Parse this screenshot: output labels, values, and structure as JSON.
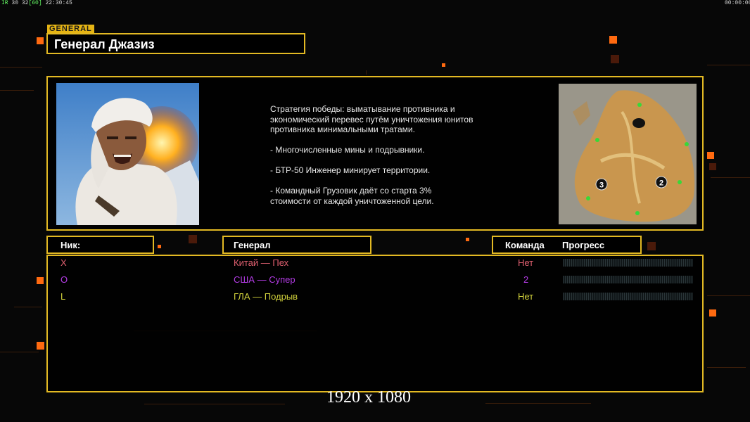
{
  "hud": {
    "stats_prefix": "IR",
    "stats_numbers": "30 32",
    "stats_fps": "[60]",
    "clock": "22:30:45",
    "timer": "00:00:00"
  },
  "general_tag": "GENERAL",
  "general_name": "Генерал Джазиз",
  "description": [
    "Стратегия победы: выматывание противника и\n экономический перевес путём уничтожения юнитов\n противника минимальными тратами.",
    "- Многочисленные мины и подрывники.",
    "- БТР-50 Инженер минирует территории.",
    "- Командный Грузовик даёт со старта 3%\n стоимости от каждой уничтоженной цели."
  ],
  "map": {
    "start_positions": [
      "3",
      "2"
    ]
  },
  "headers": {
    "nick": "Ник:",
    "general": "Генерал",
    "team": "Команда",
    "progress": "Прогресс"
  },
  "players": [
    {
      "nick": "X",
      "general": "Китай — Пех",
      "team": "Нет",
      "color": "#e06070"
    },
    {
      "nick": "O",
      "general": "США — Супер",
      "team": "2",
      "color": "#b43ce6"
    },
    {
      "nick": "L",
      "general": "ГЛА — Подрыв",
      "team": "Нет",
      "color": "#d2d23c"
    }
  ],
  "resolution": "1920 x 1080",
  "colors": {
    "accent": "#e3b923",
    "bg_square": "#ff6a10"
  }
}
